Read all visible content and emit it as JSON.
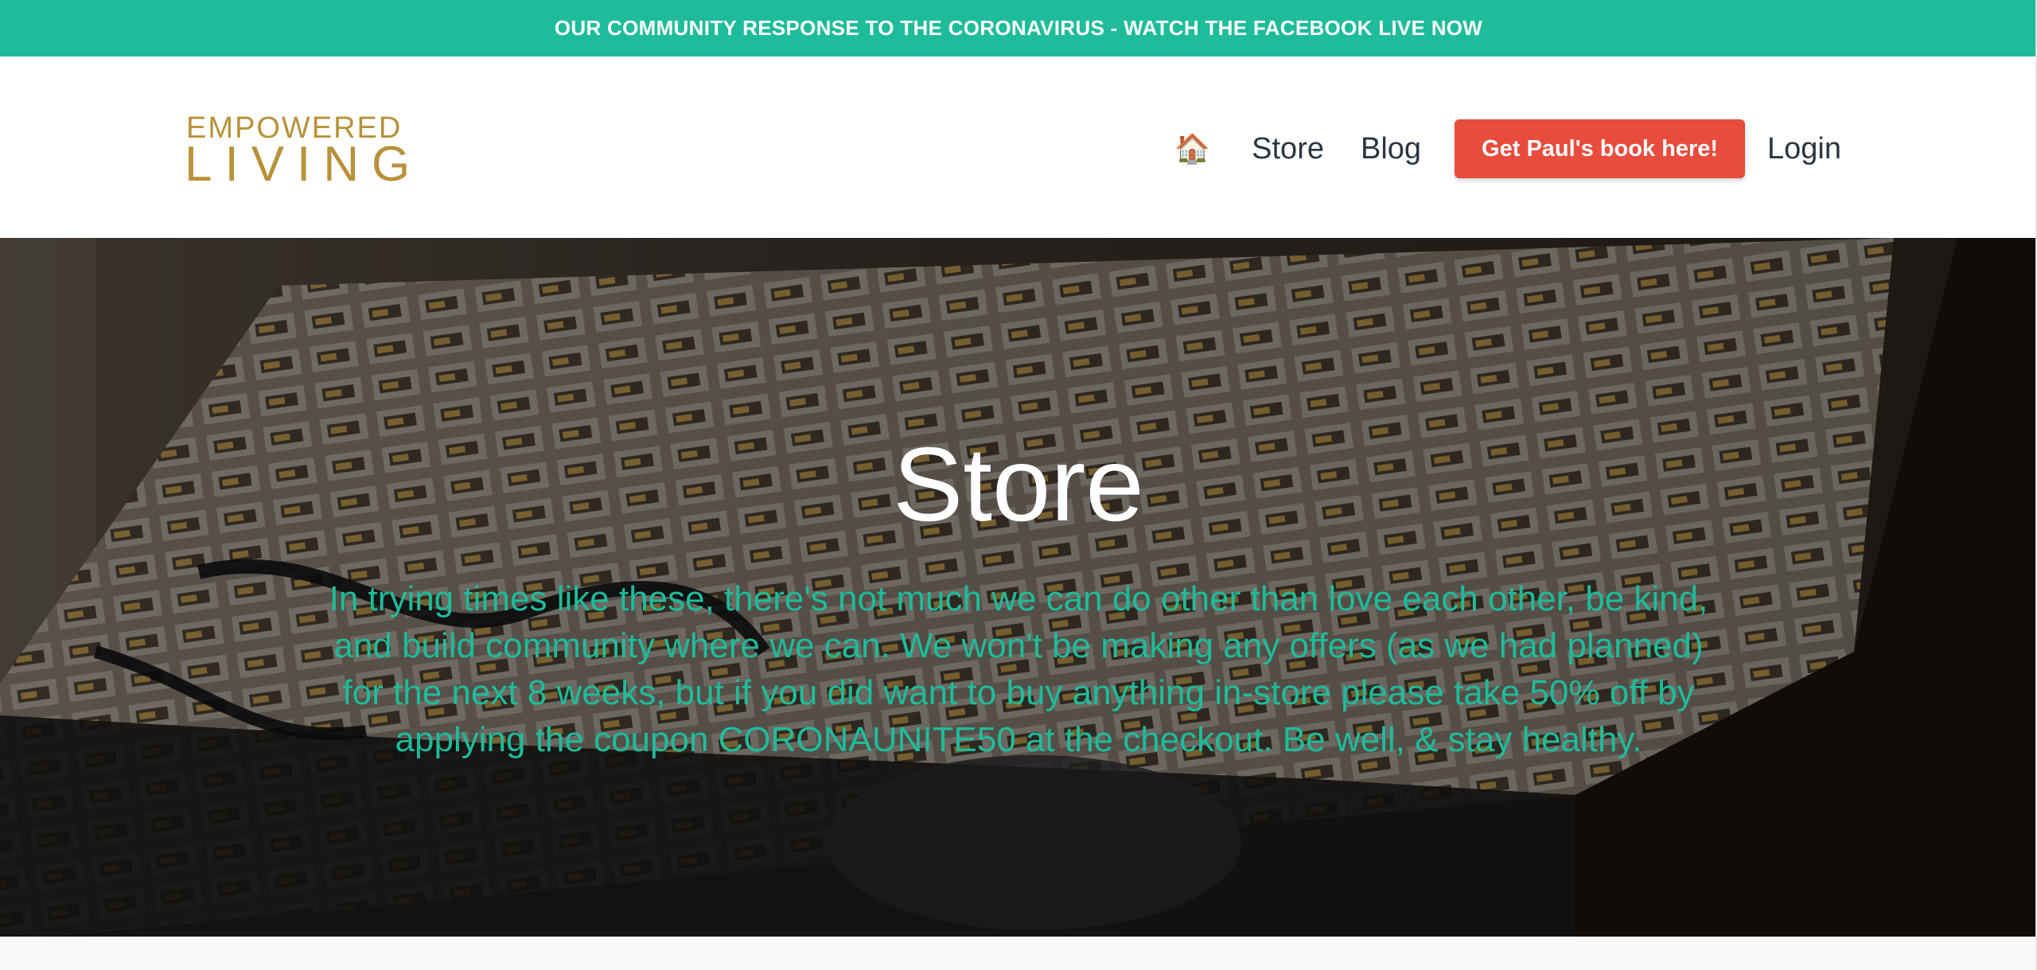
{
  "announcement": {
    "text": "OUR COMMUNITY RESPONSE TO THE CORONAVIRUS - WATCH THE FACEBOOK LIVE NOW"
  },
  "header": {
    "logo": {
      "line1": "EMPOWERED",
      "line2": "LIVING"
    },
    "nav": {
      "home_icon": "🏠",
      "store": "Store",
      "blog": "Blog",
      "cta": "Get Paul's book here!",
      "login": "Login"
    }
  },
  "hero": {
    "title": "Store",
    "text": "In trying times like these, there's not much we can do other than love each other, be kind, and build community where we can. We won't be making any offers (as we had planned) for the next 8 weeks, but if you did want to buy anything in-store please take 50% off by applying the coupon CORONAUNITE50 at the checkout. Be well, & stay healthy."
  },
  "colors": {
    "accent": "#1ebc9a",
    "cta": "#e74c3c",
    "logo_gold": "#b8923a",
    "nav_text": "#2b3540"
  }
}
